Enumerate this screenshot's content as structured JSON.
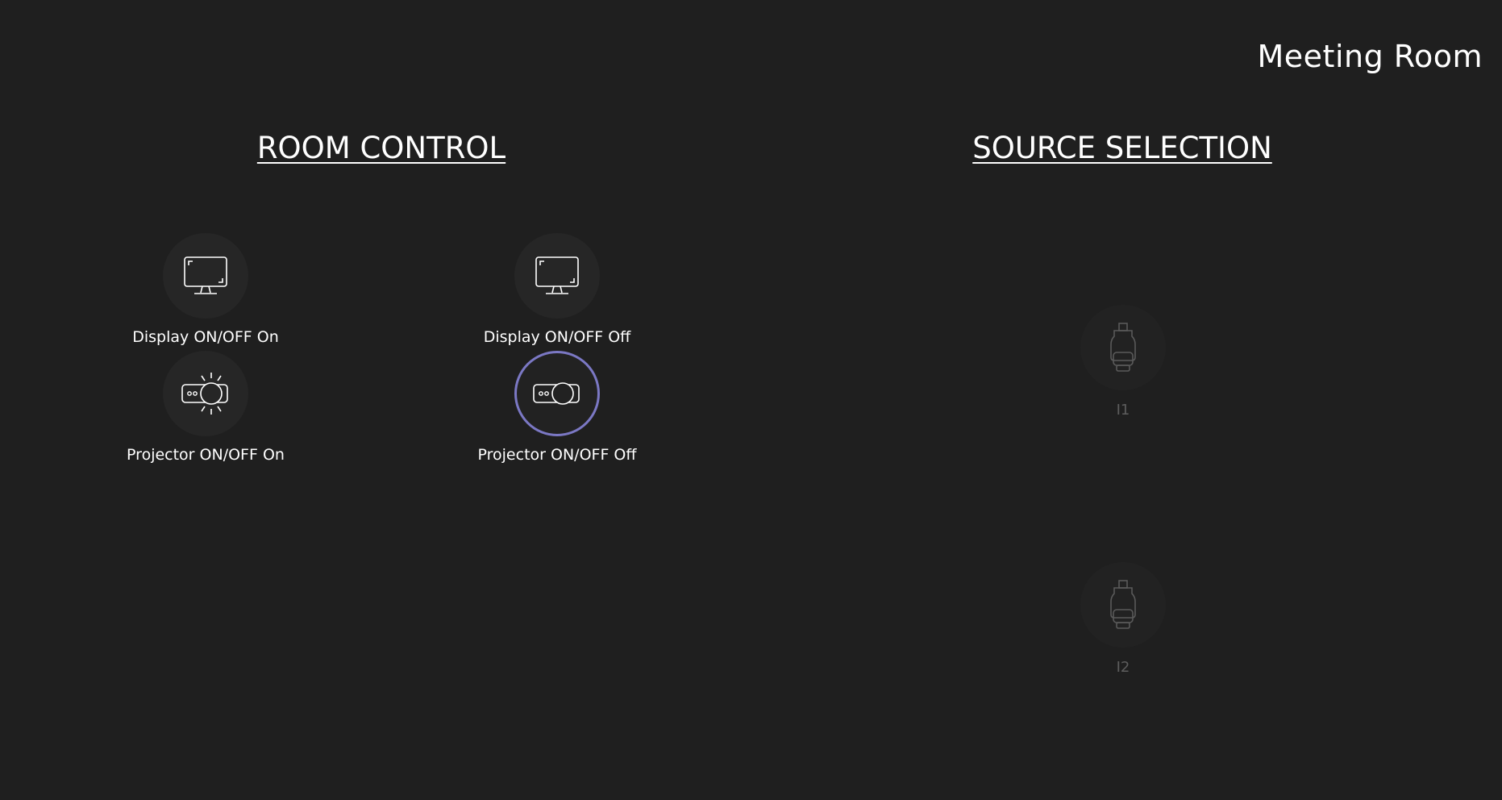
{
  "header": {
    "room_name": "Meeting Room"
  },
  "room_control": {
    "title": "ROOM CONTROL",
    "buttons": [
      {
        "label": "Display ON/OFF On",
        "icon": "monitor-icon"
      },
      {
        "label": "Display ON/OFF Off",
        "icon": "monitor-icon"
      },
      {
        "label": "Projector ON/OFF On",
        "icon": "projector-on-icon"
      },
      {
        "label": "Projector ON/OFF Off",
        "icon": "projector-icon",
        "selected": true
      }
    ]
  },
  "source_selection": {
    "title": "SOURCE SELECTION",
    "sources": [
      {
        "label": "I1",
        "icon": "hdmi-connector-icon",
        "enabled": false
      },
      {
        "label": "I2",
        "icon": "hdmi-connector-icon",
        "enabled": false
      }
    ]
  },
  "colors": {
    "background": "#1f1f1f",
    "button_circle": "#262626",
    "selected_ring": "#7b78c4",
    "disabled_text": "#5d5d5d"
  }
}
